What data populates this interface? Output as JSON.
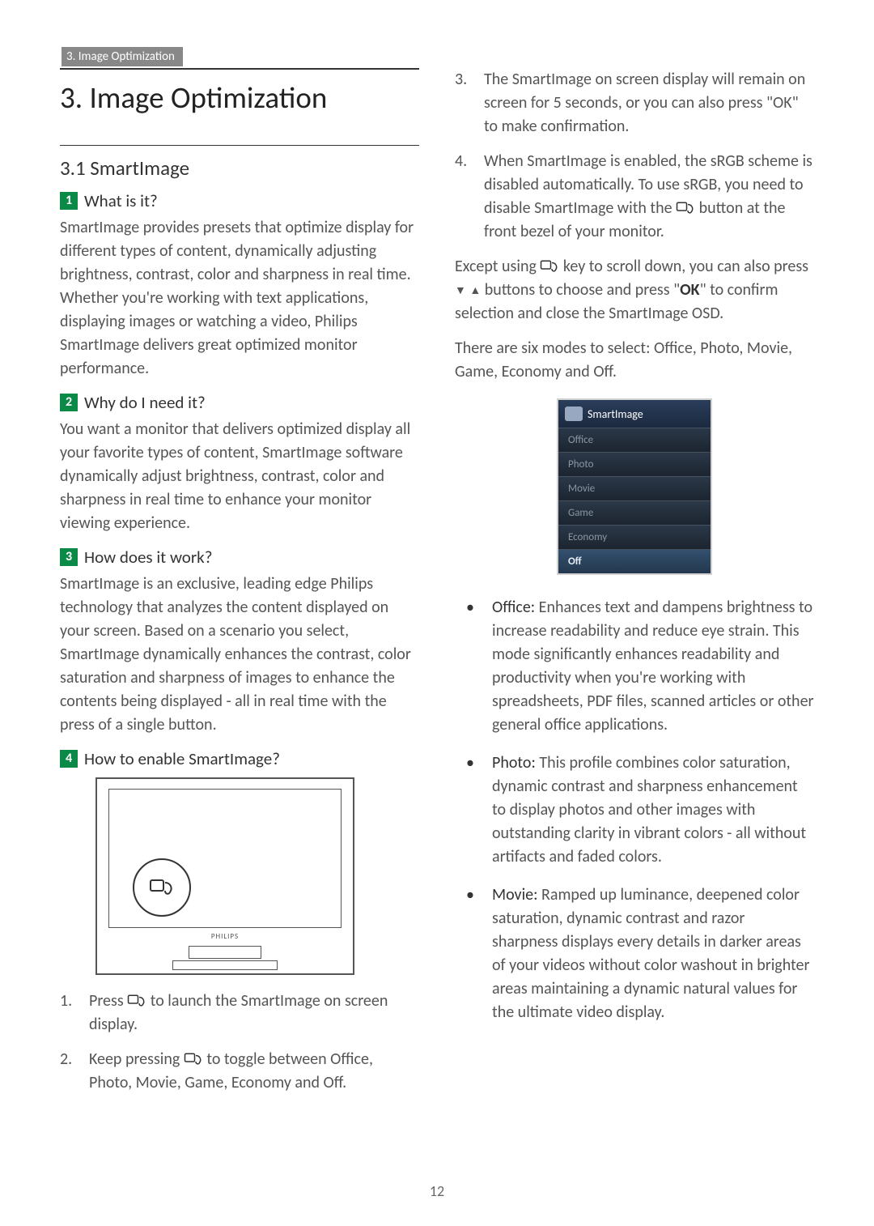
{
  "breadcrumb": "3. Image Optimization",
  "page_number": "12",
  "left": {
    "title": "3.   Image Optimization",
    "subsection": "3.1  SmartImage",
    "q1": {
      "num": "1",
      "heading": "What is it?"
    },
    "p1": "SmartImage provides presets that optimize display for different types of content, dynamically adjusting brightness, contrast, color and sharpness in real time. Whether you're working with text applications, displaying images or watching a video, Philips SmartImage delivers great optimized monitor performance.",
    "q2": {
      "num": "2",
      "heading": "Why do I need it?"
    },
    "p2": "You want a monitor that delivers optimized display all your favorite types of content, SmartImage software dynamically adjust brightness, contrast, color and sharpness in real time to enhance your monitor viewing experience.",
    "q3": {
      "num": "3",
      "heading": "How does it work?"
    },
    "p3": "SmartImage is an exclusive, leading edge Philips technology that analyzes the content displayed on your screen. Based on a scenario you select, SmartImage dynamically enhances the contrast, color saturation and sharpness of images to enhance the contents being displayed - all in real time with the press of a single button.",
    "q4": {
      "num": "4",
      "heading": "How to enable SmartImage?"
    },
    "brand": "PHILIPS",
    "steps": {
      "s1_a": "Press ",
      "s1_b": " to launch the SmartImage on screen display.",
      "s2_a": "Keep pressing ",
      "s2_b": " to toggle between Office, Photo, Movie, Game, Economy and Off."
    }
  },
  "right": {
    "steps": {
      "s3": "The SmartImage on screen display will remain on screen for 5 seconds, or you can also press \"OK\" to make confirmation.",
      "s4_a": "When SmartImage is enabled, the sRGB scheme is disabled automatically. To use sRGB, you need to disable SmartImage with the ",
      "s4_b": " button at the front bezel of your monitor."
    },
    "except_a": "Except using ",
    "except_b": " key to scroll down, you can also press ",
    "except_c": " buttons to choose and press \"",
    "ok": "OK",
    "except_d": "\" to confirm selection and close the SmartImage OSD.",
    "modes_intro": "There are six modes to select: Office, Photo, Movie, Game, Economy and Off.",
    "osd": {
      "title": "SmartImage",
      "items": [
        "Office",
        "Photo",
        "Movie",
        "Game",
        "Economy",
        "Off"
      ],
      "selected_index": 5
    },
    "modes": [
      {
        "name": "Office:",
        "desc": " Enhances text and dampens brightness to increase readability and reduce eye strain. This mode significantly enhances readability and productivity when you're working with spreadsheets, PDF files, scanned articles or other general office applications."
      },
      {
        "name": "Photo:",
        "desc": " This profile combines color saturation, dynamic contrast and sharpness enhancement to display photos and other images with outstanding clarity in vibrant colors - all without artifacts and faded colors."
      },
      {
        "name": "Movie:",
        "desc": " Ramped up luminance, deepened color saturation, dynamic contrast and razor sharpness displays every details in darker areas of your videos without color washout in brighter areas maintaining a dynamic natural values for the ultimate video display."
      }
    ]
  }
}
